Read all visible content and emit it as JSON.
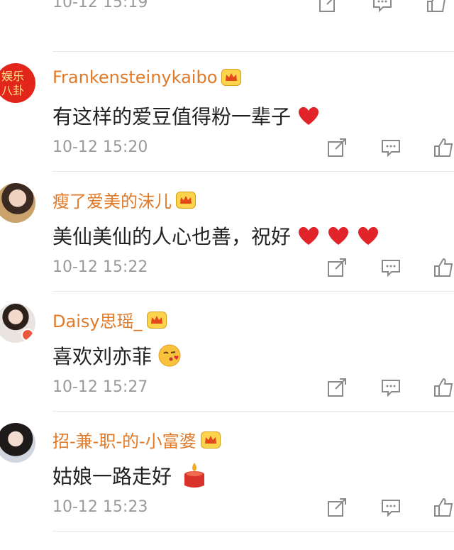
{
  "top_partial": {
    "time": "10-12 15:19"
  },
  "comments": [
    {
      "username": "Frankensteinykaibo",
      "text": "有这样的爱豆值得粉一辈子",
      "time": "10-12 15:20",
      "avatar_text": "娱乐八卦",
      "hearts": 1
    },
    {
      "username": "瘦了爱美的沫儿",
      "text": "美仙美仙的人心也善，祝好",
      "time": "10-12 15:22",
      "hearts": 3
    },
    {
      "username": "Daisy思瑶_",
      "text": "喜欢刘亦菲",
      "time": "10-12 15:27",
      "emoji": "kiss-emoji"
    },
    {
      "username": "招-兼-职-的-小富婆",
      "text": "姑娘一路走好",
      "time": "10-12 15:23",
      "emoji": "candle-emoji"
    }
  ],
  "colors": {
    "username": "#e07a29",
    "heart": "#e0242a",
    "time": "#9a9a9a"
  }
}
